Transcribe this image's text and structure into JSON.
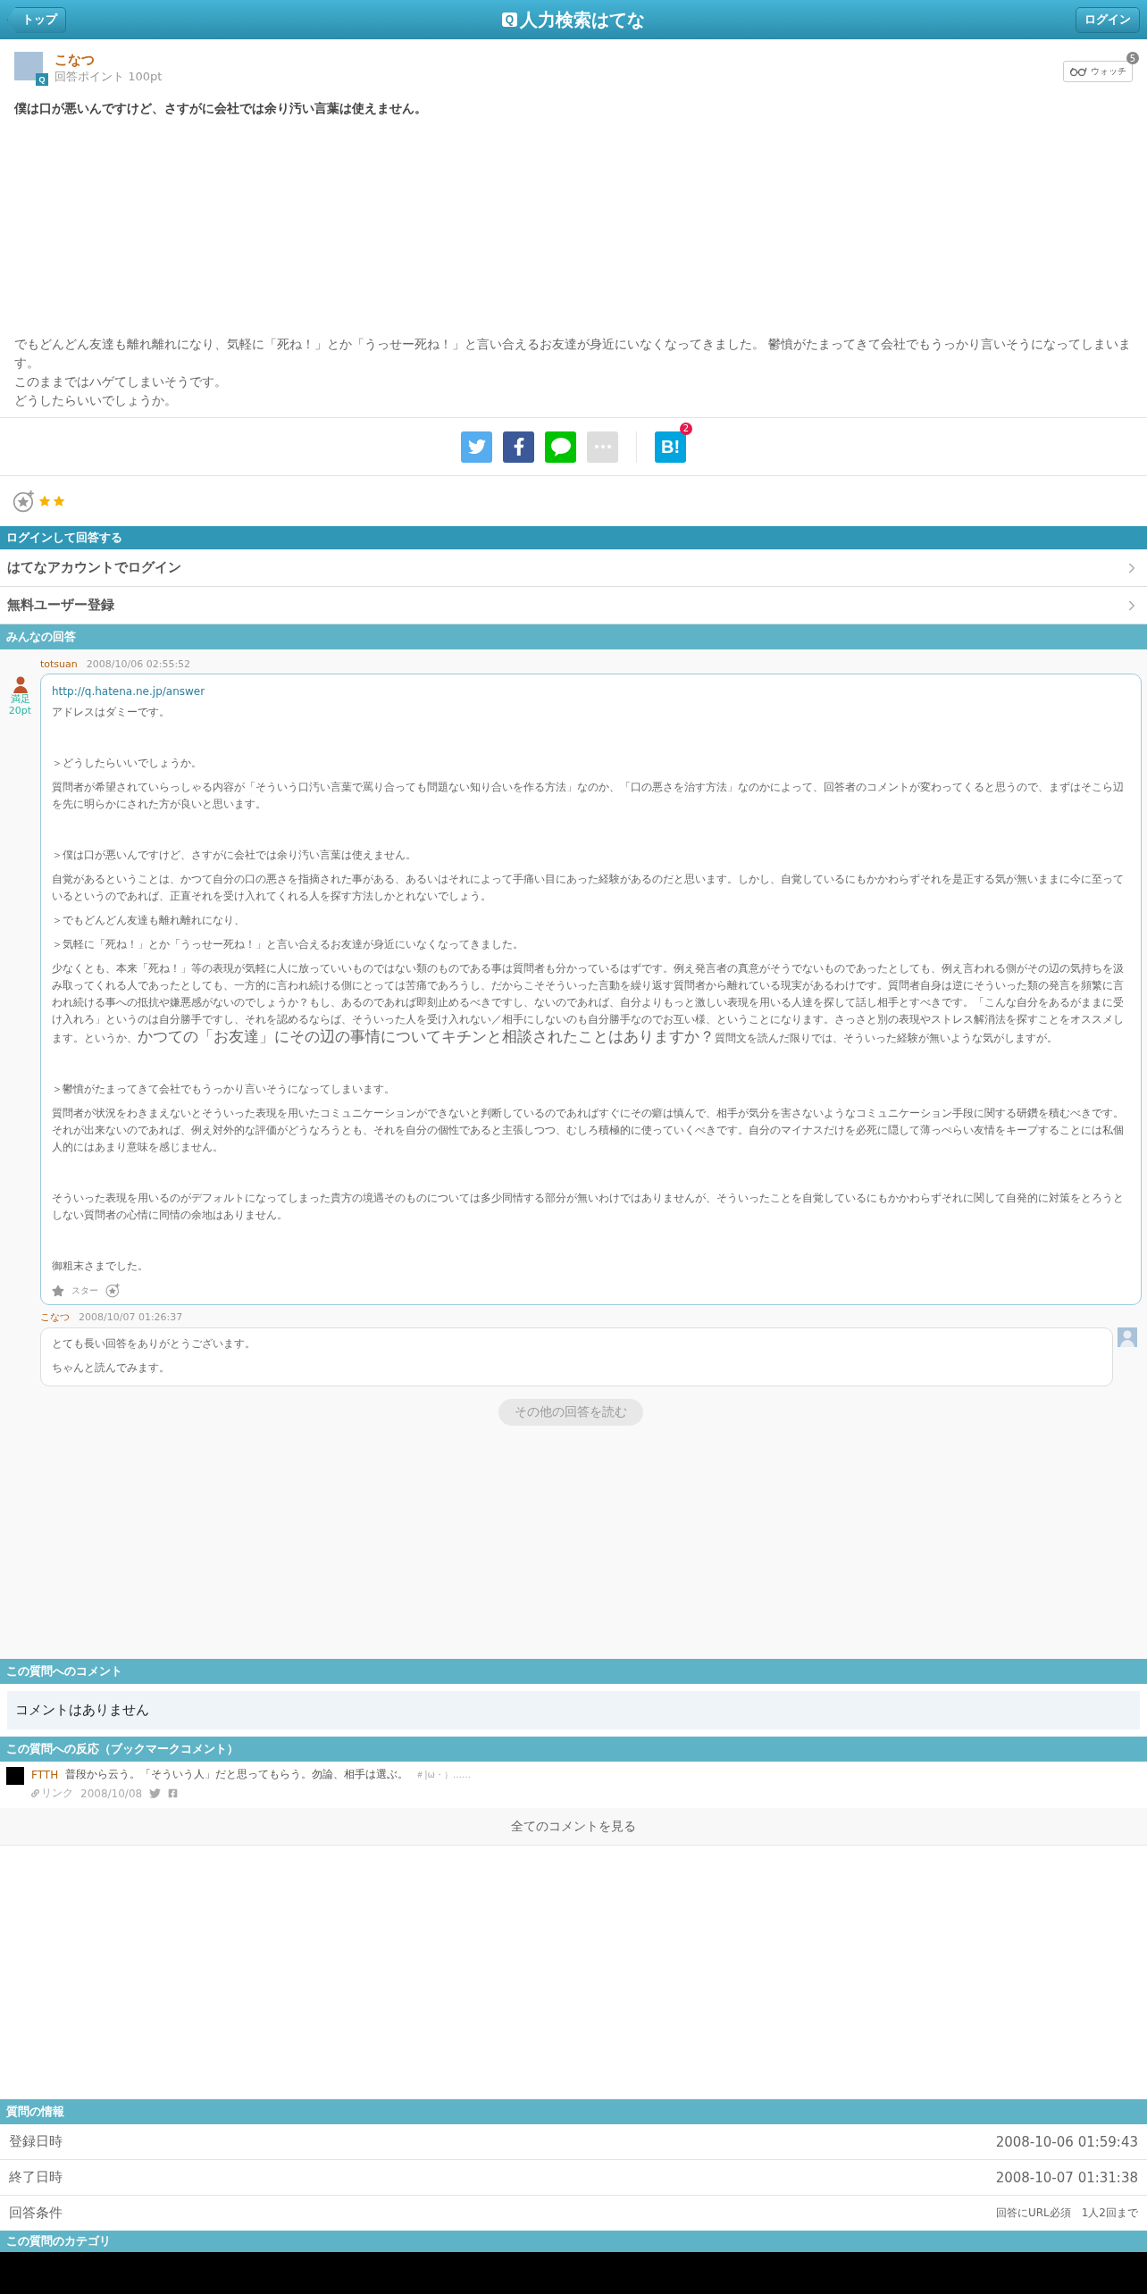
{
  "header": {
    "back": "トップ",
    "title_icon": "Q",
    "title": "人力検索はてな",
    "login": "ログイン"
  },
  "question": {
    "user": "こなつ",
    "avatar_badge": "Q",
    "points": "回答ポイント 100pt",
    "watch": {
      "label": "ウォッチ",
      "count": "5"
    },
    "title": "僕は口が悪いんですけど、さすがに会社では余り汚い言葉は使えません。",
    "body": [
      "でもどんどん友達も離れ離れになり、気軽に「死ね！」とか「うっせー死ね！」と言い合えるお友達が身近にいなくなってきました。 鬱憤がたまってきて会社でもうっかり言いそうになってしまいます。",
      "このままではハゲてしまいそうです。",
      "どうしたらいいでしょうか。"
    ]
  },
  "share": {
    "buttons": [
      {
        "kind": "twitter"
      },
      {
        "kind": "facebook"
      },
      {
        "kind": "line"
      },
      {
        "kind": "more"
      }
    ],
    "bookmark": {
      "label": "B!",
      "count": "2"
    }
  },
  "rating": {
    "given_stars": [
      {
        "kind": "yellow"
      },
      {
        "kind": "yellow"
      }
    ]
  },
  "login_section": {
    "title": "ログインして回答する",
    "items": [
      "はてなアカウントでログイン",
      "無料ユーザー登録"
    ]
  },
  "answers_section": {
    "title": "みんなの回答",
    "answer": {
      "user": "totsuan",
      "date": "2008/10/06 02:55:52",
      "rating": "満足",
      "points": "20pt",
      "link": "http://q.hatena.ne.jp/answer",
      "star_label": "スター",
      "groups": [
        [
          {
            "text": "アドレスはダミーです。"
          }
        ],
        [
          {
            "text": "＞どうしたらいいでしょうか。"
          },
          {
            "text": "質問者が希望されていらっしゃる内容が「そういう口汚い言葉で罵り合っても問題ない知り合いを作る方法」なのか、「口の悪さを治す方法」なのかによって、回答者のコメントが変わってくると思うので、まずはそこら辺を先に明らかにされた方が良いと思います。"
          }
        ],
        [
          {
            "text": "＞僕は口が悪いんですけど、さすがに会社では余り汚い言葉は使えません。"
          },
          {
            "text": "自覚があるということは、かつて自分の口の悪さを指摘された事がある、あるいはそれによって手痛い目にあった経験があるのだと思います。しかし、自覚しているにもかかわらずそれを是正する気が無いままに今に至っているというのであれば、正直それを受け入れてくれる人を探す方法しかとれないでしょう。"
          },
          {
            "text": "＞でもどんどん友達も離れ離れになり、"
          },
          {
            "text": "＞気軽に「死ね！」とか「うっせー死ね！」と言い合えるお友達が身近にいなくなってきました。"
          },
          {
            "parts": [
              {
                "kind": "plain",
                "text": "少なくとも、本来「死ね！」等の表現が気軽に人に放っていいものではない類のものである事は質問者も分かっているはずです。例え発言者の真意がそうでないものであったとしても、例え言われる側がその辺の気持ちを汲み取ってくれる人であったとしても、一方的に言われ続ける側にとっては苦痛であろうし、だからこそそういった言動を繰り返す質問者から離れている現実があるわけです。質問者自身は逆にそういった類の発言を頻繁に言われ続ける事への抵抗や嫌悪感がないのでしょうか？もし、あるのであれば即刻止めるべきですし、ないのであれば、自分よりもっと激しい表現を用いる人達を探して話し相手とすべきです。「こんな自分をあるがままに受け入れろ」というのは自分勝手ですし、それを認めるならば、そういった人を受け入れない／相手にしないのも自分勝手なのでお互い様、ということになります。さっさと別の表現やストレス解消法を探すことをオススメします。というか、"
              },
              {
                "kind": "emphasis",
                "text": "かつての「お友達」にその辺の事情についてキチンと相談されたことはありますか？"
              },
              {
                "kind": "plain",
                "text": "質問文を読んだ限りでは、そういった経験が無いような気がしますが。"
              }
            ]
          }
        ],
        [
          {
            "text": "＞鬱憤がたまってきて会社でもうっかり言いそうになってしまいます。"
          },
          {
            "text": "質問者が状況をわきまえないとそういった表現を用いたコミュニケーションができないと判断しているのであればすぐにその癖は慎んで、相手が気分を害さないようなコミュニケーション手段に関する研鑽を積むべきです。それが出来ないのであれば、例え対外的な評価がどうなろうとも、それを自分の個性であると主張しつつ、むしろ積極的に使っていくべきです。自分のマイナスだけを必死に隠して薄っぺらい友情をキープすることには私個人的にはあまり意味を感じません。"
          }
        ],
        [
          {
            "text": "そういった表現を用いるのがデフォルトになってしまった貴方の境遇そのものについては多少同情する部分が無いわけではありませんが、そういったことを自覚しているにもかかわらずそれに関して自発的に対策をとろうとしない質問者の心情に同情の余地はありません。"
          }
        ],
        [
          {
            "text": "御粗末さまでした。"
          }
        ]
      ]
    },
    "reply": {
      "user": "こなつ",
      "date": "2008/10/07 01:26:37",
      "lines": [
        "とても長い回答をありがとうございます。",
        "ちゃんと読んでみます。"
      ]
    },
    "more": "その他の回答を読む"
  },
  "comments_section": {
    "title": "この質問へのコメント",
    "empty": "コメントはありません"
  },
  "reactions_section": {
    "title": "この質問への反応（ブックマークコメント）",
    "items": [
      {
        "user": "FTTH",
        "comment": "普段から云う。「そういう人」だと思ってもらう。勿論、相手は選ぶ。",
        "tags": "＃|ω・）……",
        "link": "リンク",
        "date": "2008/10/08"
      }
    ],
    "all": "全てのコメントを見る"
  },
  "info_section": {
    "title": "質問の情報",
    "rows": [
      {
        "label": "登録日時",
        "value": "2008-10-06 01:59:43",
        "kind": "large"
      },
      {
        "label": "終了日時",
        "value": "2008-10-07 01:31:38",
        "kind": "large"
      },
      {
        "label": "回答条件",
        "value": "回答にURL必須　1人2回まで",
        "kind": "small"
      }
    ]
  },
  "category_section": {
    "title": "この質問のカテゴリ"
  }
}
